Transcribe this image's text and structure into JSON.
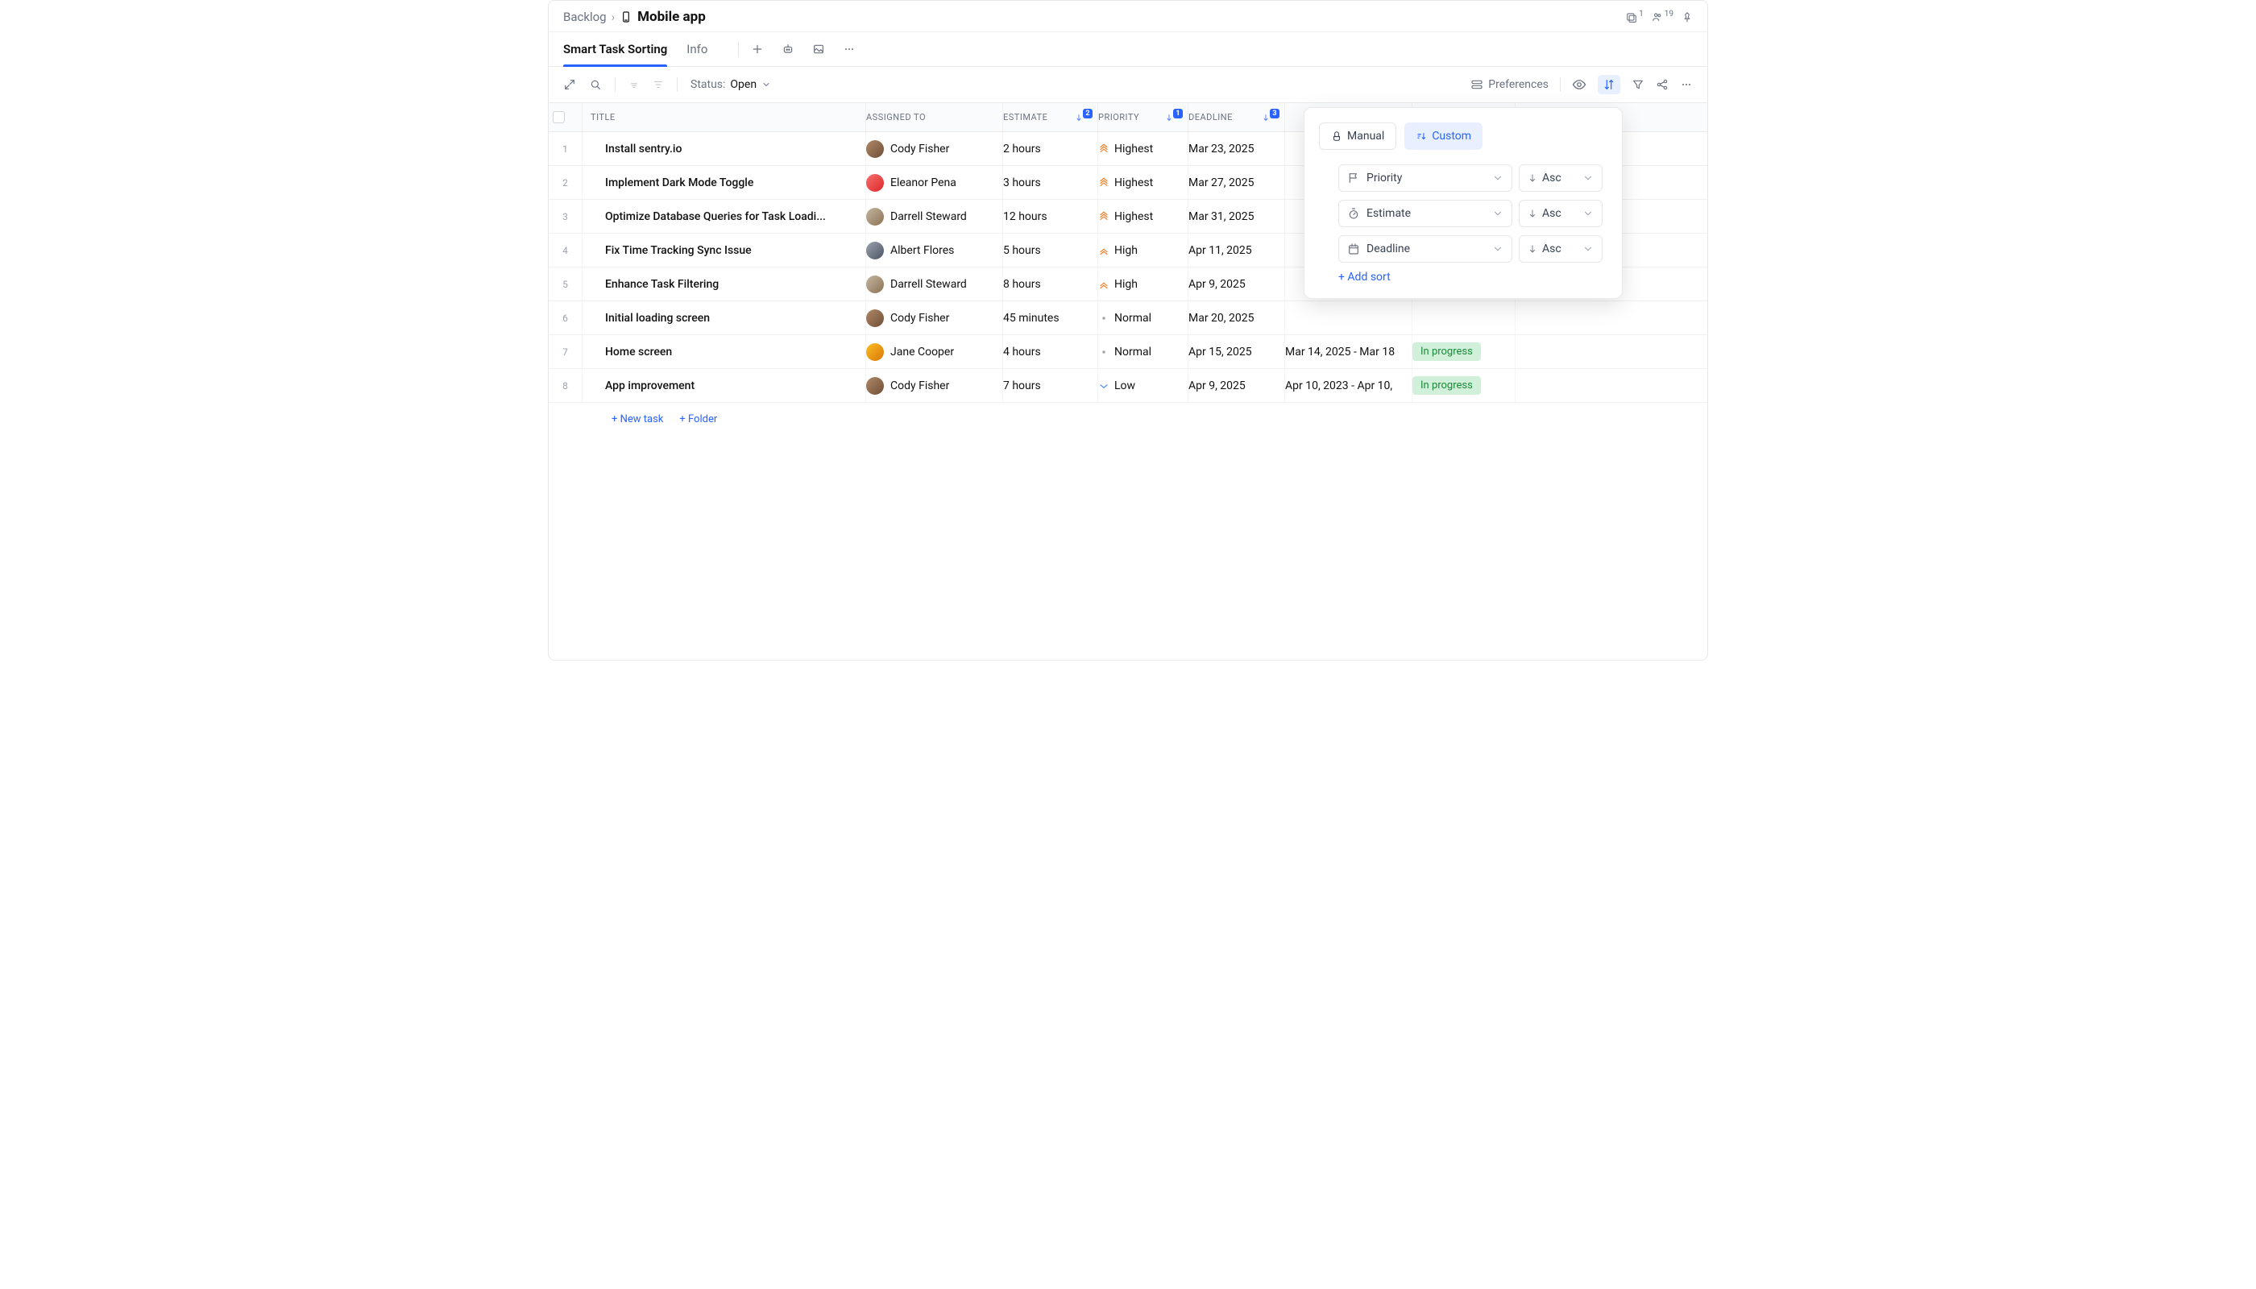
{
  "breadcrumb": {
    "parent": "Backlog",
    "title": "Mobile app"
  },
  "header_stats": {
    "alt_count": "1",
    "people_count": "19"
  },
  "tabs": {
    "active": "Smart Task Sorting",
    "info": "Info"
  },
  "toolbar": {
    "status_label": "Status:",
    "status_value": "Open",
    "preferences": "Preferences"
  },
  "columns": {
    "title": "Title",
    "assigned": "Assigned To",
    "estimate": "Estimate",
    "priority": "Priority",
    "deadline": "Deadline"
  },
  "sort_badges": {
    "estimate": "2",
    "priority": "1",
    "deadline": "3"
  },
  "rows": [
    {
      "num": "1",
      "title": "Install sentry.io",
      "assignee": "Cody Fisher",
      "avatar": "av-1",
      "estimate": "2 hours",
      "priority": "Highest",
      "prio_level": "highest",
      "deadline": "Mar 23, 2025",
      "duration": "",
      "status": ""
    },
    {
      "num": "2",
      "title": "Implement Dark Mode Toggle",
      "assignee": "Eleanor Pena",
      "avatar": "av-2",
      "estimate": "3 hours",
      "priority": "Highest",
      "prio_level": "highest",
      "deadline": "Mar 27, 2025",
      "duration": "",
      "status": ""
    },
    {
      "num": "3",
      "title": "Optimize Database Queries for Task Loadi...",
      "assignee": "Darrell Steward",
      "avatar": "av-3",
      "estimate": "12 hours",
      "priority": "Highest",
      "prio_level": "highest",
      "deadline": "Mar 31, 2025",
      "duration": "",
      "status": ""
    },
    {
      "num": "4",
      "title": "Fix Time Tracking Sync Issue",
      "assignee": "Albert Flores",
      "avatar": "av-4",
      "estimate": "5 hours",
      "priority": "High",
      "prio_level": "high",
      "deadline": "Apr 11, 2025",
      "duration": "",
      "status": ""
    },
    {
      "num": "5",
      "title": "Enhance Task Filtering",
      "assignee": "Darrell Steward",
      "avatar": "av-3",
      "estimate": "8 hours",
      "priority": "High",
      "prio_level": "high",
      "deadline": "Apr 9, 2025",
      "duration": "",
      "status": ""
    },
    {
      "num": "6",
      "title": "Initial loading screen",
      "assignee": "Cody Fisher",
      "avatar": "av-1",
      "estimate": "45 minutes",
      "priority": "Normal",
      "prio_level": "normal",
      "deadline": "Mar 20, 2025",
      "duration": "",
      "status": ""
    },
    {
      "num": "7",
      "title": "Home screen",
      "assignee": "Jane Cooper",
      "avatar": "av-5",
      "estimate": "4 hours",
      "priority": "Normal",
      "prio_level": "normal",
      "deadline": "Apr 15, 2025",
      "duration": "Mar 14, 2025 - Mar 18",
      "status": "In progress"
    },
    {
      "num": "8",
      "title": "App improvement",
      "assignee": "Cody Fisher",
      "avatar": "av-1",
      "estimate": "7 hours",
      "priority": "Low",
      "prio_level": "low",
      "deadline": "Apr 9, 2025",
      "duration": "Apr 10, 2023 - Apr 10,",
      "status": "In progress"
    }
  ],
  "footer": {
    "new_task": "+ New task",
    "folder": "+ Folder"
  },
  "sort_panel": {
    "manual": "Manual",
    "custom": "Custom",
    "rows": [
      {
        "field": "Priority",
        "dir": "Asc",
        "icon": "flag"
      },
      {
        "field": "Estimate",
        "dir": "Asc",
        "icon": "timer"
      },
      {
        "field": "Deadline",
        "dir": "Asc",
        "icon": "calendar"
      }
    ],
    "add": "+ Add sort"
  }
}
